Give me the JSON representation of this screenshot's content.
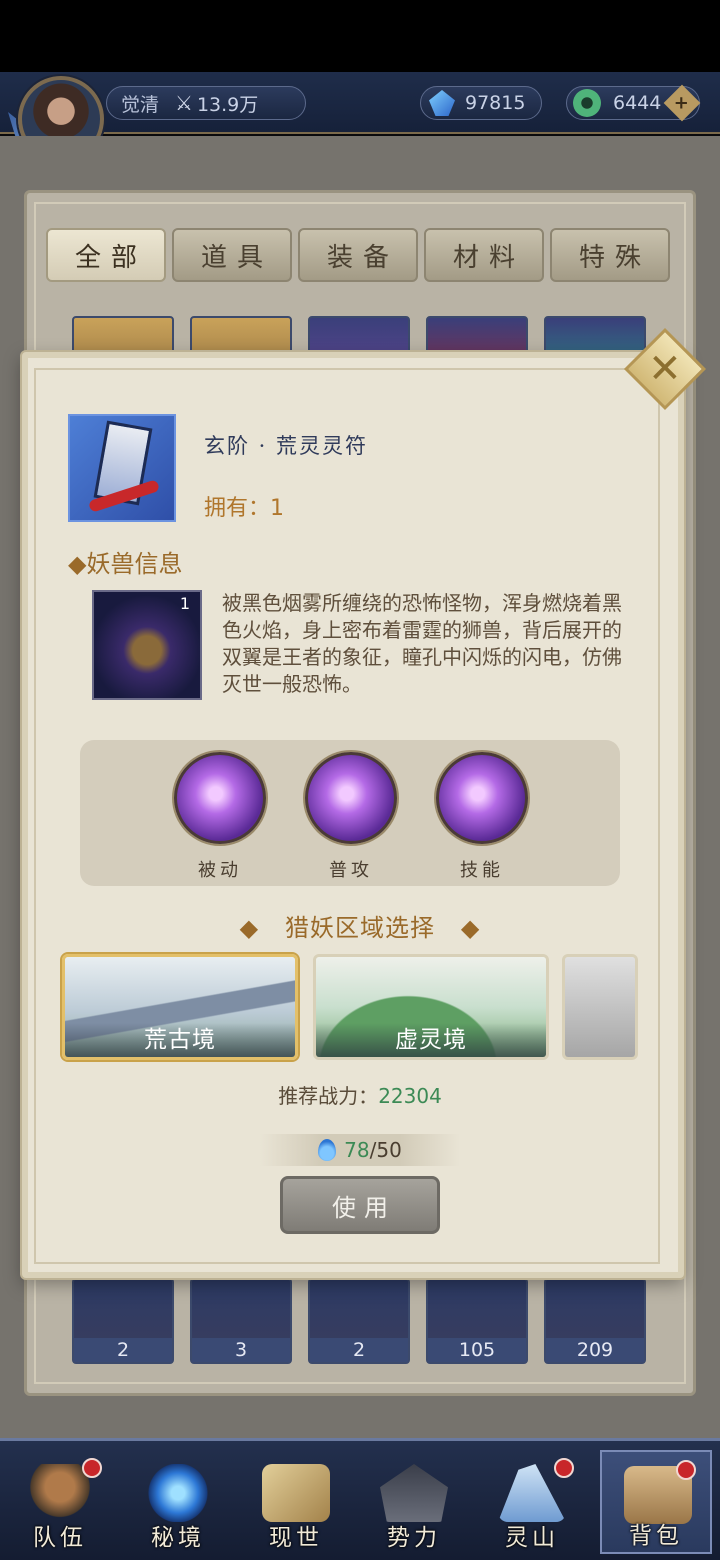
{
  "player": {
    "name": "觉清",
    "power": "13.9万"
  },
  "currency": {
    "gems": "97815",
    "jade": "6444",
    "plus": "+"
  },
  "tabs": [
    "全部",
    "道具",
    "装备",
    "材料",
    "特殊"
  ],
  "bag_counts": [
    "2",
    "3",
    "2",
    "105",
    "209"
  ],
  "popup": {
    "close": "✕",
    "item_name": "玄阶 · 荒灵灵符",
    "owned": "拥有：1",
    "section_beast": "◆妖兽信息",
    "beast_count": "1",
    "beast_description": "被黑色烟雾所缠绕的恐怖怪物，浑身燃烧着黑色火焰，身上密布着雷霆的狮兽，背后展开的双翼是王者的象征，瞳孔中闪烁的闪电，仿佛灭世一般恐怖。",
    "skills": [
      "被动",
      "普攻",
      "技能"
    ],
    "region_title": "◆   猎妖区域选择   ◆",
    "regions": [
      "荒古境",
      "虚灵境",
      ""
    ],
    "recommend_label": "推荐战力：",
    "recommend_value": "22304",
    "energy_current": "78",
    "energy_max": "/50",
    "use_button": "使用"
  },
  "bottom_nav": [
    "队伍",
    "秘境",
    "现世",
    "势力",
    "灵山",
    "背包"
  ],
  "colors": {
    "accent_gold": "#b0762c",
    "value_green": "#3c8a55",
    "notify_red": "#c8262a"
  }
}
